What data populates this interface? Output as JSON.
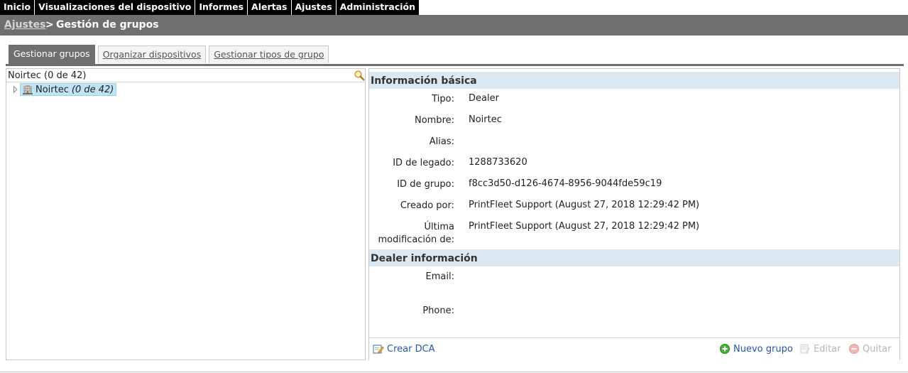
{
  "nav": {
    "items": [
      "Inicio",
      "Visualizaciones del dispositivo",
      "Informes",
      "Alertas",
      "Ajustes",
      "Administración"
    ]
  },
  "breadcrumb": {
    "parent": "Ajustes",
    "separator": ">",
    "current": "Gestión de grupos"
  },
  "tabs": [
    {
      "label": "Gestionar grupos",
      "active": true
    },
    {
      "label": "Organizar dispositivos",
      "active": false
    },
    {
      "label": "Gestionar tipos de grupo",
      "active": false
    }
  ],
  "tree": {
    "header": "Noirtec (0 de 42)",
    "node": {
      "name": "Noirtec",
      "count": "(0 de 42)"
    }
  },
  "basic": {
    "title": "Información básica",
    "rows": [
      {
        "label": "Tipo:",
        "value": "Dealer"
      },
      {
        "label": "Nombre:",
        "value": "Noirtec"
      },
      {
        "label": "Alias:",
        "value": ""
      },
      {
        "label": "ID de legado:",
        "value": "1288733620"
      },
      {
        "label": "ID de grupo:",
        "value": "f8cc3d50-d126-4674-8956-9044fde59c19"
      },
      {
        "label": "Creado por:",
        "value": "PrintFleet Support (August 27, 2018 12:29:42 PM)"
      },
      {
        "label_line1": "Última",
        "label_line2": "modificación de:",
        "value": "PrintFleet Support (August 27, 2018 12:29:42 PM)"
      }
    ]
  },
  "dealer": {
    "title": "Dealer información",
    "rows": [
      {
        "label": "Email:",
        "value": ""
      },
      {
        "label": "Phone:",
        "value": ""
      }
    ]
  },
  "footer": {
    "create_dca": "Crear DCA",
    "new_group": "Nuevo grupo",
    "edit": "Editar",
    "remove": "Quitar"
  },
  "colors": {
    "nav_bg": "#000000",
    "breadcrumb_bg": "#6f6f6f",
    "section_header_bg": "#dce9f3",
    "selected_node_bg": "#bfe4f4",
    "link": "#2455b0",
    "disabled": "#b7b7b7"
  }
}
